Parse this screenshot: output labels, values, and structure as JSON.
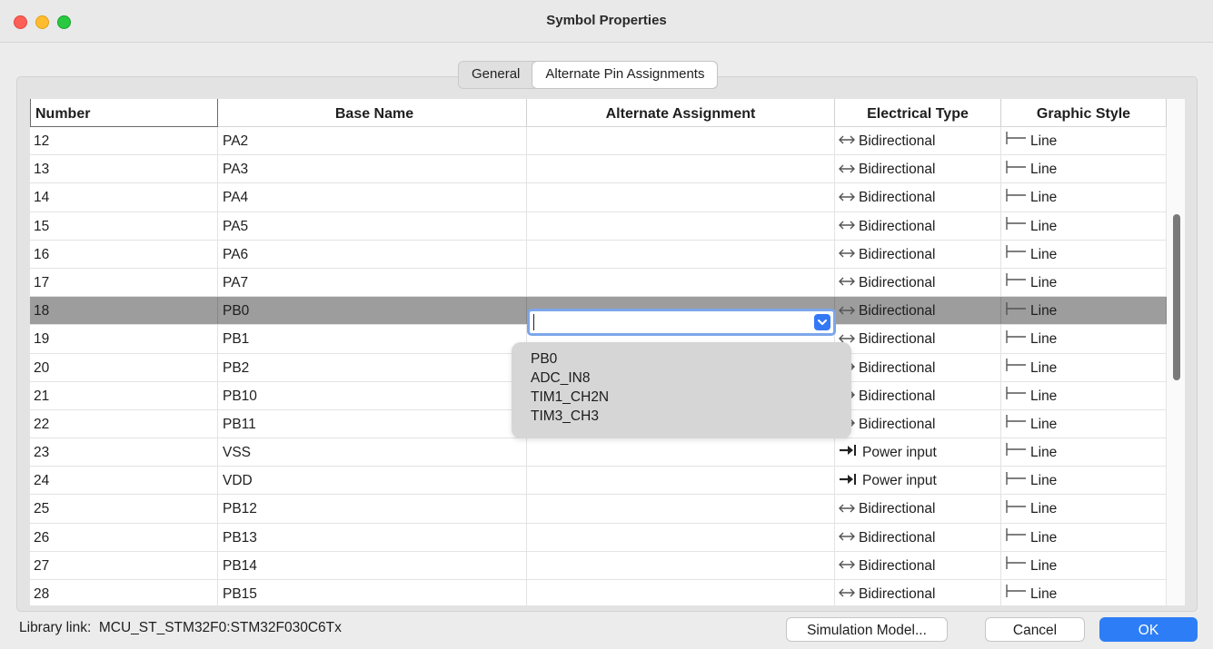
{
  "window": {
    "title": "Symbol Properties"
  },
  "tabs": [
    {
      "label": "General",
      "active": false
    },
    {
      "label": "Alternate Pin Assignments",
      "active": true
    }
  ],
  "table": {
    "columns": [
      "Number",
      "Base Name",
      "Alternate Assignment",
      "Electrical Type",
      "Graphic Style"
    ],
    "rows": [
      {
        "number": "12",
        "base": "PA2",
        "alt": "",
        "etype": "Bidirectional",
        "eicon": "bidirectional-arrow-icon",
        "style": "Line"
      },
      {
        "number": "13",
        "base": "PA3",
        "alt": "",
        "etype": "Bidirectional",
        "eicon": "bidirectional-arrow-icon",
        "style": "Line"
      },
      {
        "number": "14",
        "base": "PA4",
        "alt": "",
        "etype": "Bidirectional",
        "eicon": "bidirectional-arrow-icon",
        "style": "Line"
      },
      {
        "number": "15",
        "base": "PA5",
        "alt": "",
        "etype": "Bidirectional",
        "eicon": "bidirectional-arrow-icon",
        "style": "Line"
      },
      {
        "number": "16",
        "base": "PA6",
        "alt": "",
        "etype": "Bidirectional",
        "eicon": "bidirectional-arrow-icon",
        "style": "Line"
      },
      {
        "number": "17",
        "base": "PA7",
        "alt": "",
        "etype": "Bidirectional",
        "eicon": "bidirectional-arrow-icon",
        "style": "Line"
      },
      {
        "number": "18",
        "base": "PB0",
        "alt": "",
        "etype": "Bidirectional",
        "eicon": "bidirectional-arrow-icon",
        "style": "Line",
        "selected": true
      },
      {
        "number": "19",
        "base": "PB1",
        "alt": "",
        "etype": "Bidirectional",
        "eicon": "bidirectional-arrow-icon",
        "style": "Line"
      },
      {
        "number": "20",
        "base": "PB2",
        "alt": "",
        "etype": "Bidirectional",
        "eicon": "bidirectional-arrow-icon",
        "style": "Line"
      },
      {
        "number": "21",
        "base": "PB10",
        "alt": "",
        "etype": "Bidirectional",
        "eicon": "bidirectional-arrow-icon",
        "style": "Line"
      },
      {
        "number": "22",
        "base": "PB11",
        "alt": "",
        "etype": "Bidirectional",
        "eicon": "bidirectional-arrow-icon",
        "style": "Line"
      },
      {
        "number": "23",
        "base": "VSS",
        "alt": "",
        "etype": "Power input",
        "eicon": "power-input-icon",
        "style": "Line"
      },
      {
        "number": "24",
        "base": "VDD",
        "alt": "",
        "etype": "Power input",
        "eicon": "power-input-icon",
        "style": "Line"
      },
      {
        "number": "25",
        "base": "PB12",
        "alt": "",
        "etype": "Bidirectional",
        "eicon": "bidirectional-arrow-icon",
        "style": "Line"
      },
      {
        "number": "26",
        "base": "PB13",
        "alt": "",
        "etype": "Bidirectional",
        "eicon": "bidirectional-arrow-icon",
        "style": "Line"
      },
      {
        "number": "27",
        "base": "PB14",
        "alt": "",
        "etype": "Bidirectional",
        "eicon": "bidirectional-arrow-icon",
        "style": "Line"
      },
      {
        "number": "28",
        "base": "PB15",
        "alt": "",
        "etype": "Bidirectional",
        "eicon": "bidirectional-arrow-icon",
        "style": "Line"
      }
    ]
  },
  "alt_dropdown": {
    "value": "",
    "options": [
      "PB0",
      "ADC_IN8",
      "TIM1_CH2N",
      "TIM3_CH3"
    ]
  },
  "footer": {
    "library_label": "Library link:",
    "library_value": "MCU_ST_STM32F0:STM32F030C6Tx",
    "simulation_button": "Simulation Model...",
    "cancel_button": "Cancel",
    "ok_button": "OK"
  },
  "colors": {
    "accent": "#2d7ef6",
    "selected_row": "#9d9d9d",
    "dropdown_bg": "#d6d6d6"
  }
}
